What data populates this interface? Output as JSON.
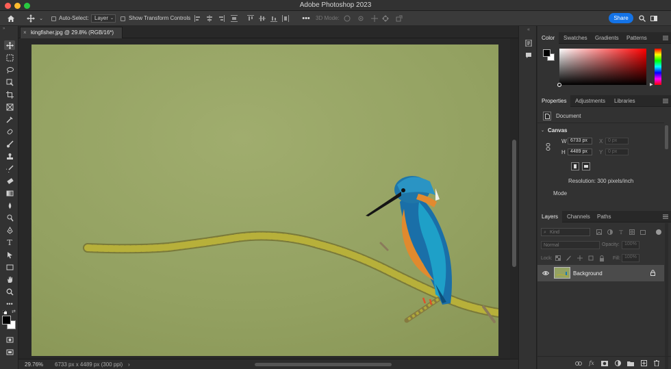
{
  "window": {
    "title": "Adobe Photoshop 2023"
  },
  "options_bar": {
    "auto_select_label": "Auto-Select:",
    "auto_select_value": "Layer",
    "transform_controls_label": "Show Transform Controls",
    "mode_3d_label": "3D Mode:",
    "share_label": "Share"
  },
  "document": {
    "tab_title": "kingfisher.jpg @ 29.8% (RGB/16*)",
    "status_zoom": "29.76%",
    "status_info": "6733 px x 4489 px (300 ppi)"
  },
  "color_panel": {
    "tabs": [
      "Color",
      "Swatches",
      "Gradients",
      "Patterns"
    ],
    "active_tab": "Color"
  },
  "properties_panel": {
    "tabs": [
      "Properties",
      "Adjustments",
      "Libraries"
    ],
    "document_label": "Document",
    "canvas_heading": "Canvas",
    "w_label": "W",
    "w_value": "6733 px",
    "h_label": "H",
    "h_value": "4489 px",
    "x_label": "X",
    "x_value": "0 px",
    "y_label": "Y",
    "y_value": "0 px",
    "resolution": "Resolution: 300 pixels/inch",
    "mode_label": "Mode"
  },
  "layers_panel": {
    "tabs": [
      "Layers",
      "Channels",
      "Paths"
    ],
    "kind_placeholder": "Kind",
    "blend_mode": "Normal",
    "opacity_label": "Opacity:",
    "opacity_value": "100%",
    "lock_label": "Lock:",
    "fill_label": "Fill:",
    "fill_value": "100%",
    "layers": [
      {
        "name": "Background",
        "visible": true,
        "locked": true
      }
    ]
  },
  "colors": {
    "accent": "#1473e6",
    "photo_bg": "#94a263"
  }
}
